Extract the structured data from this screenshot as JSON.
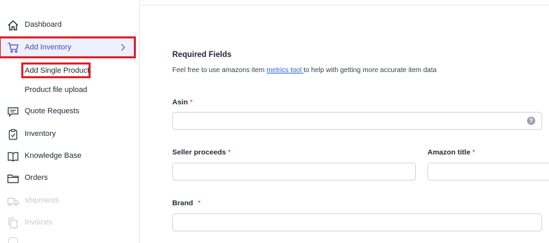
{
  "sidebar": {
    "items": [
      {
        "label": "Dashboard",
        "icon": "home-icon"
      },
      {
        "label": "Add Inventory",
        "icon": "cart-icon"
      },
      {
        "label": "Quote Requests",
        "icon": "chat-icon"
      },
      {
        "label": "Inventory",
        "icon": "clipboard-icon"
      },
      {
        "label": "Knowledge Base",
        "icon": "book-icon"
      },
      {
        "label": "Orders",
        "icon": "folder-icon"
      },
      {
        "label": "shipments",
        "icon": "truck-icon"
      },
      {
        "label": "Invoices",
        "icon": "copy-icon"
      }
    ],
    "sub_items": [
      {
        "label": "Add Single Product"
      },
      {
        "label": "Product file upload"
      }
    ]
  },
  "form": {
    "section_title": "Required Fields",
    "description_before": "Feel free to use amazons item ",
    "description_link": "metrics tool ",
    "description_after": "to help with getting more accurate item data",
    "asin_label": "Asin",
    "seller_proceeds_label": "Seller proceeds",
    "amazon_title_label": "Amazon title",
    "brand_label": "Brand",
    "required_mark": "*",
    "help_glyph": "?"
  },
  "colors": {
    "accent": "#4f46c8",
    "highlight": "#e0202a",
    "link": "#2563eb",
    "required": "#e11d48"
  }
}
